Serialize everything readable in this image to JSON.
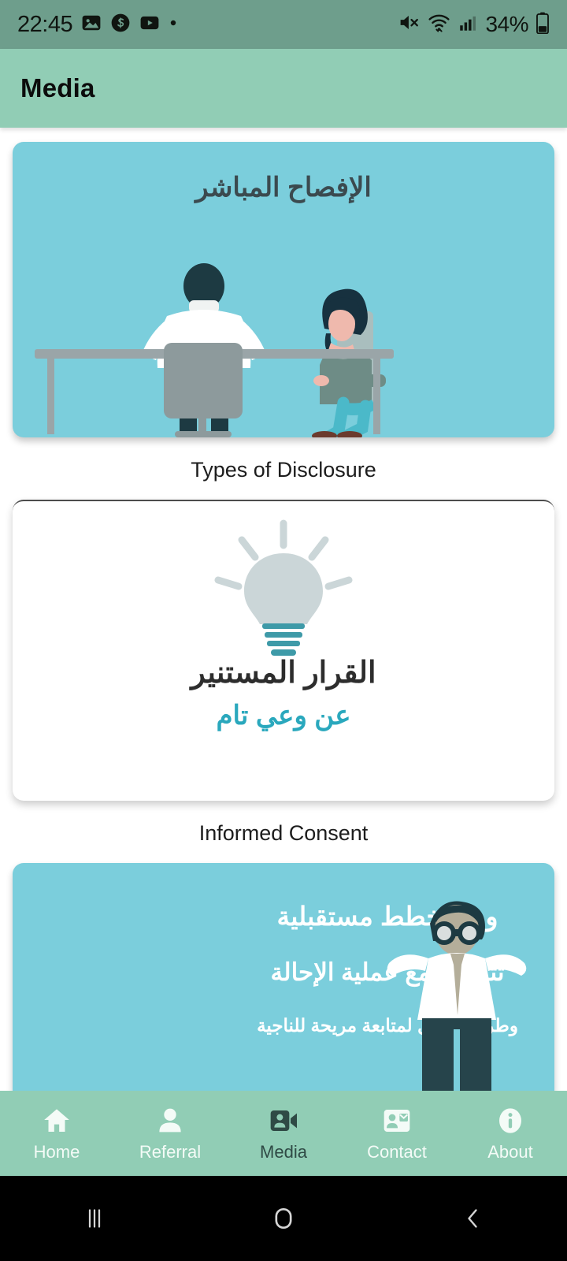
{
  "status_bar": {
    "time": "22:45",
    "battery_percent": "34%",
    "left_icons": [
      "gallery-icon",
      "s-app-icon",
      "youtube-icon",
      "more-dot-icon"
    ],
    "right_icons": [
      "mute-icon",
      "wifi-icon",
      "signal-icon",
      "battery-icon"
    ],
    "background": "#6E9E8C"
  },
  "app_bar": {
    "title": "Media",
    "background": "#91CDB5"
  },
  "colors": {
    "card_teal": "#7BCEDC",
    "accent_teal_text": "#2AA8BD",
    "nav_background": "#91CDB5",
    "heading_dark": "#3B4A4F"
  },
  "cards": [
    {
      "id": "types-of-disclosure",
      "title_ar": "الإفصاح المباشر",
      "caption": "Types of Disclosure",
      "illustration": "doctor-patient-desk-illustration",
      "background": "#7BCEDC"
    },
    {
      "id": "informed-consent",
      "line1_ar": "القرار المستنير",
      "line2_ar": "عن وعي تام",
      "caption": "Informed Consent",
      "illustration": "lightbulb-icon",
      "background": "#FFFFFF"
    },
    {
      "id": "future-plans",
      "line1_ar": "وضع خطط مستقبلية",
      "line2_ar": "تترافق مع عملية الإحالة",
      "line3_ar": "وطرق تواصل لمتابعة مريحة للناجية",
      "illustration": "man-with-binoculars-illustration",
      "background": "#7BCEDC"
    }
  ],
  "bottom_nav": {
    "items": [
      {
        "label": "Home",
        "icon": "home-icon",
        "active": false
      },
      {
        "label": "Referral",
        "icon": "person-icon",
        "active": false
      },
      {
        "label": "Media",
        "icon": "video-user-icon",
        "active": true
      },
      {
        "label": "Contact",
        "icon": "contact-card-icon",
        "active": false
      },
      {
        "label": "About",
        "icon": "info-icon",
        "active": false
      }
    ]
  },
  "system_nav": {
    "recents": "recents-icon",
    "home": "home-circle-icon",
    "back": "back-icon"
  }
}
